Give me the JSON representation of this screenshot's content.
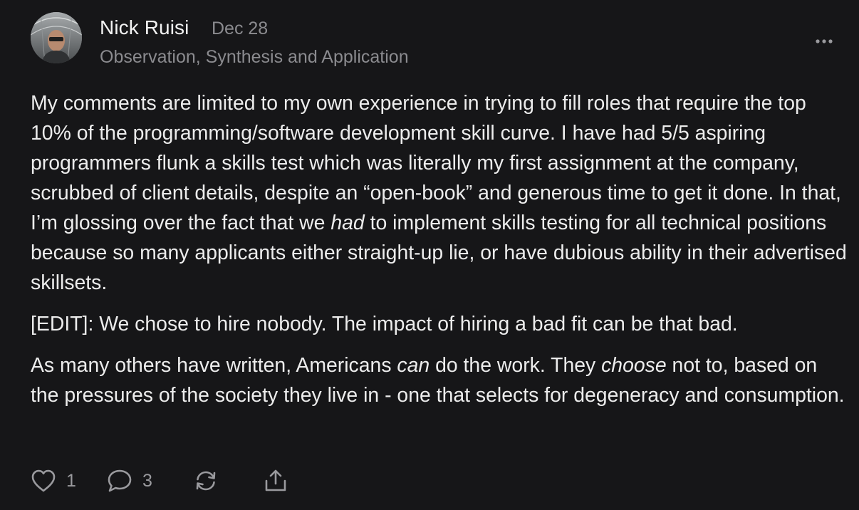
{
  "comment": {
    "author": {
      "name": "Nick Ruisi",
      "publication": "Observation, Synthesis and Application",
      "avatar_icon": "avatar-photo"
    },
    "date": "Dec 28",
    "body": {
      "p1": "My comments are limited to my own experience in trying to fill roles that require the top 10% of the programming/software development skill curve. I have had 5/5 aspiring programmers flunk a skills test which was literally my first assignment at the company, scrubbed of client details, despite an “open-book” and generous time to get it done. In that, I’m glossing over the fact that we ",
      "p1_em": "had",
      "p1_end": " to implement skills testing for all technical positions because so many applicants either straight-up lie, or have dubious ability in their advertised skillsets.",
      "p2": "[EDIT]: We chose to hire nobody. The impact of hiring a bad fit can be that bad.",
      "p3_a": "As many others have written, Americans ",
      "p3_em1": "can",
      "p3_b": " do the work. They ",
      "p3_em2": "choose",
      "p3_c": " not to, based on the pressures of the society they live in - one that selects for degeneracy and consumption."
    },
    "actions": {
      "like_count": "1",
      "reply_count": "3",
      "like_icon": "heart-icon",
      "reply_icon": "speech-bubble-icon",
      "restack_icon": "restack-icon",
      "share_icon": "share-icon",
      "more_icon": "more-dots-icon"
    }
  },
  "colors": {
    "background": "#161618",
    "text": "#ececec",
    "muted": "#8b8b8f"
  }
}
